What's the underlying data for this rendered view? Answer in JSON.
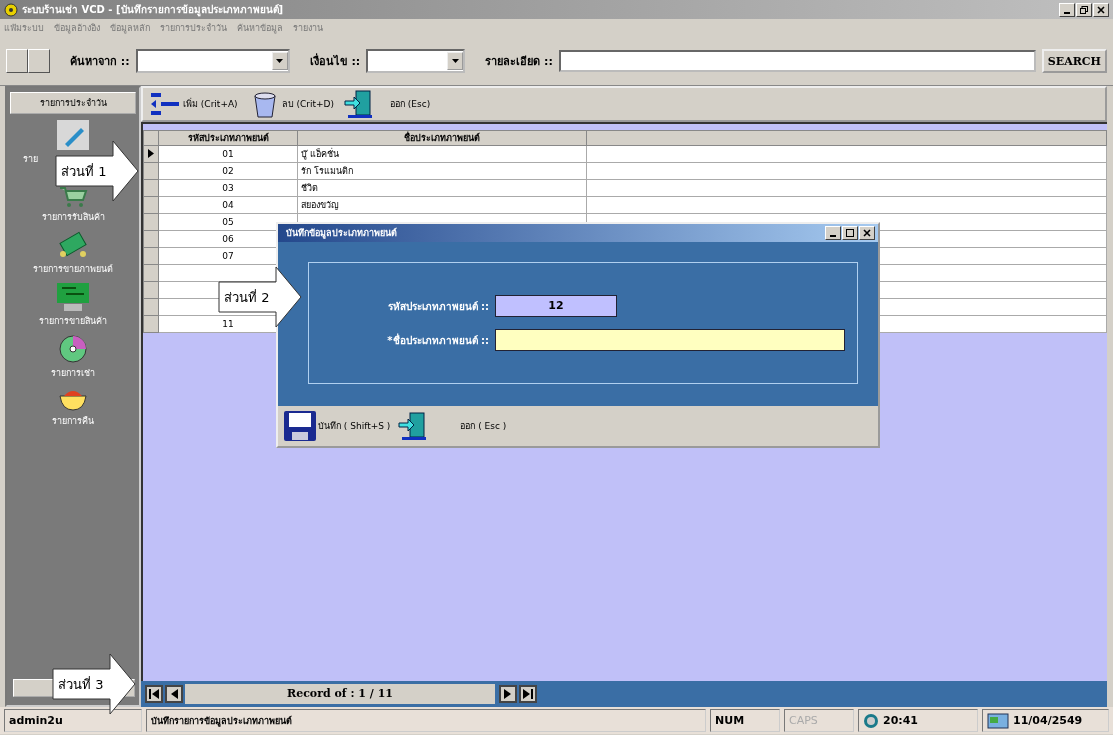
{
  "window": {
    "title": "ระบบร้านเช่า VCD - [บันทึกรายการข้อมูลประเภทภาพยนต์]"
  },
  "menu": [
    "แฟ้มระบบ",
    "ข้อมูลอ้างอิง",
    "ข้อมูลหลัก",
    "รายการประจำวัน",
    "ค้นหาข้อมูล",
    "รายงาน"
  ],
  "search_bar": {
    "from_label": "ค้นหาจาก ::",
    "condition_label": "เงื่อนไข ::",
    "detail_label": "รายละเอียด ::",
    "button": "SEARCH"
  },
  "sidebar": {
    "header": "รายการประจำวัน",
    "items": [
      {
        "kind": "pencil",
        "label": "ราย"
      },
      {
        "kind": "cart",
        "label": "รายการรับสินค้า"
      },
      {
        "kind": "money",
        "label": "รายการขายภาพยนต์"
      },
      {
        "kind": "board",
        "label": "รายการขายสินค้า"
      },
      {
        "kind": "disc",
        "label": "รายการเช่า"
      },
      {
        "kind": "bowl",
        "label": "รายการคืน"
      }
    ]
  },
  "toolbar": [
    {
      "kind": "add",
      "label": "เพิ่ม (Crit+A)"
    },
    {
      "kind": "delete",
      "label": "ลบ (Crit+D)"
    },
    {
      "kind": "exit",
      "label": "ออก (Esc)"
    }
  ],
  "table": {
    "columns": [
      "รหัสประเภทภาพยนต์",
      "ชื่อประเภทภาพยนต์"
    ],
    "rows": [
      {
        "code": "01",
        "name": "บู๊ แอ็คชั่น",
        "selected": true
      },
      {
        "code": "02",
        "name": "รัก โรแมนติก",
        "selected": false
      },
      {
        "code": "03",
        "name": "ชีวิต",
        "selected": false
      },
      {
        "code": "04",
        "name": "สยองขวัญ",
        "selected": false
      },
      {
        "code": "05",
        "selected": false
      },
      {
        "code": "06",
        "selected": false
      },
      {
        "code": "07",
        "selected": false
      },
      {
        "selected": false
      },
      {
        "selected": false
      },
      {
        "selected": false
      },
      {
        "code": "11",
        "selected": false
      }
    ]
  },
  "dialog": {
    "title": "บันทึกข้อมูลประเภทภาพยนต์",
    "fields": [
      {
        "kind": "readonly",
        "label": "รหัสประเภทภาพยนต์ ::",
        "value": "12"
      },
      {
        "kind": "input",
        "label": "*ชื่อประเภทภาพยนต์ ::"
      }
    ],
    "buttons": [
      {
        "kind": "save",
        "label": "บันทึก ( Shift+S )"
      },
      {
        "kind": "exit",
        "label": "ออก ( Esc )"
      }
    ]
  },
  "navigator": {
    "record": "Record of  :  1 / 11"
  },
  "callouts": [
    {
      "label": "ส่วนที่ 1"
    },
    {
      "label": "ส่วนที่ 2"
    },
    {
      "label": "ส่วนที่ 3"
    }
  ],
  "status_bar": {
    "user": "admin2u",
    "message": "บันทึกรายการข้อมูลประเภทภาพยนต์",
    "indicators": [
      {
        "label": "NUM",
        "on": true
      },
      {
        "label": "CAPS",
        "on": false
      }
    ],
    "time": "20:41",
    "date": "11/04/2549"
  }
}
